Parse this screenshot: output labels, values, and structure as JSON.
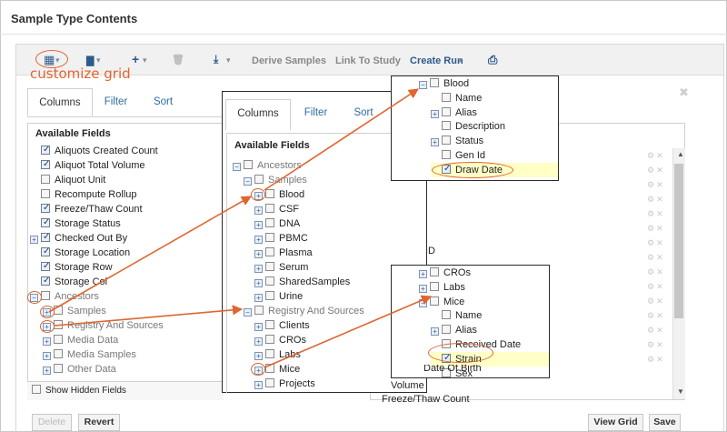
{
  "header": {
    "title": "Sample Type Contents"
  },
  "toolbar": {
    "grid_icon": "▦",
    "chart_icon": "▇",
    "add_icon": "+",
    "delete_icon": "🗑",
    "download_icon": "⤓",
    "derive_samples": "Derive Samples",
    "link_to_study": "Link To Study",
    "create_run": "Create Run",
    "print_icon": "⎙",
    "dropdown_caret": "▾"
  },
  "annotation": {
    "label": "customize grid",
    "color": "#e06530"
  },
  "tabs": {
    "columns": "Columns",
    "filter": "Filter",
    "sort": "Sort"
  },
  "available_fields_label": "Available Fields",
  "main_fields": [
    {
      "label": "Aliquots Created Count",
      "checked": true
    },
    {
      "label": "Aliquot Total Volume",
      "checked": true
    },
    {
      "label": "Aliquot Unit",
      "checked": false
    },
    {
      "label": "Recompute Rollup",
      "checked": false
    },
    {
      "label": "Freeze/Thaw Count",
      "checked": true
    },
    {
      "label": "Storage Status",
      "checked": true
    },
    {
      "label": "Checked Out By",
      "checked": true,
      "toggle": "+"
    },
    {
      "label": "Storage Location",
      "checked": true
    },
    {
      "label": "Storage Row",
      "checked": true
    },
    {
      "label": "Storage Col",
      "checked": true
    },
    {
      "label": "Ancestors",
      "checked": false,
      "toggle": "−",
      "gray": true
    },
    {
      "label": "Samples",
      "checked": false,
      "toggle": "+",
      "gray": true,
      "indent": 1
    },
    {
      "label": "Registry And Sources",
      "checked": false,
      "toggle": "+",
      "gray": true,
      "indent": 1
    },
    {
      "label": "Media Data",
      "checked": false,
      "toggle": "+",
      "gray": true,
      "indent": 1
    },
    {
      "label": "Media Samples",
      "checked": false,
      "toggle": "+",
      "gray": true,
      "indent": 1
    },
    {
      "label": "Other Data",
      "checked": false,
      "toggle": "+",
      "gray": true,
      "indent": 1
    }
  ],
  "show_hidden_fields": "Show Hidden Fields",
  "buttons": {
    "delete": "Delete",
    "revert": "Revert",
    "view_grid": "View Grid",
    "save": "Save"
  },
  "close_icon": "✖",
  "mid_fields": [
    {
      "label": "Ancestors",
      "toggle": "−",
      "gray": true,
      "indent": 0
    },
    {
      "label": "Samples",
      "toggle": "−",
      "gray": true,
      "indent": 1
    },
    {
      "label": "Blood",
      "toggle": "+",
      "indent": 2
    },
    {
      "label": "CSF",
      "toggle": "+",
      "indent": 2
    },
    {
      "label": "DNA",
      "toggle": "+",
      "indent": 2
    },
    {
      "label": "PBMC",
      "toggle": "+",
      "indent": 2
    },
    {
      "label": "Plasma",
      "toggle": "+",
      "indent": 2
    },
    {
      "label": "Serum",
      "toggle": "+",
      "indent": 2
    },
    {
      "label": "SharedSamples",
      "toggle": "+",
      "indent": 2
    },
    {
      "label": "Urine",
      "toggle": "+",
      "indent": 2
    },
    {
      "label": "Registry And Sources",
      "toggle": "−",
      "gray": true,
      "indent": 1
    },
    {
      "label": "Clients",
      "toggle": "+",
      "indent": 2
    },
    {
      "label": "CROs",
      "toggle": "+",
      "indent": 2
    },
    {
      "label": "Labs",
      "toggle": "+",
      "indent": 2
    },
    {
      "label": "Mice",
      "toggle": "+",
      "indent": 2
    },
    {
      "label": "Projects",
      "toggle": "+",
      "indent": 2
    }
  ],
  "blood_fields": [
    {
      "label": "Blood",
      "toggle": "−",
      "indent": 0
    },
    {
      "label": "Name",
      "indent": 1
    },
    {
      "label": "Alias",
      "toggle": "+",
      "indent": 1
    },
    {
      "label": "Description",
      "indent": 1
    },
    {
      "label": "Status",
      "toggle": "+",
      "indent": 1
    },
    {
      "label": "Gen Id",
      "indent": 1
    },
    {
      "label": "Draw Date",
      "indent": 1,
      "checked": true,
      "highlight": true
    }
  ],
  "mice_fields": [
    {
      "label": "CROs",
      "toggle": "+",
      "indent": 0
    },
    {
      "label": "Labs",
      "toggle": "+",
      "indent": 0
    },
    {
      "label": "Mice",
      "toggle": "−",
      "indent": 0
    },
    {
      "label": "Name",
      "indent": 1
    },
    {
      "label": "Alias",
      "toggle": "+",
      "indent": 1
    },
    {
      "label": "Received Date",
      "indent": 1
    },
    {
      "label": "Strain",
      "indent": 1,
      "checked": true,
      "highlight": true
    },
    {
      "label": "Sex",
      "indent": 1
    }
  ],
  "right_partial": {
    "id_fragment": "ID",
    "date_of_birth_fragment": "Date Of Birth",
    "volume_fragment": "Volume",
    "freeze_thaw_fragment": "Freeze/Thaw Count"
  }
}
